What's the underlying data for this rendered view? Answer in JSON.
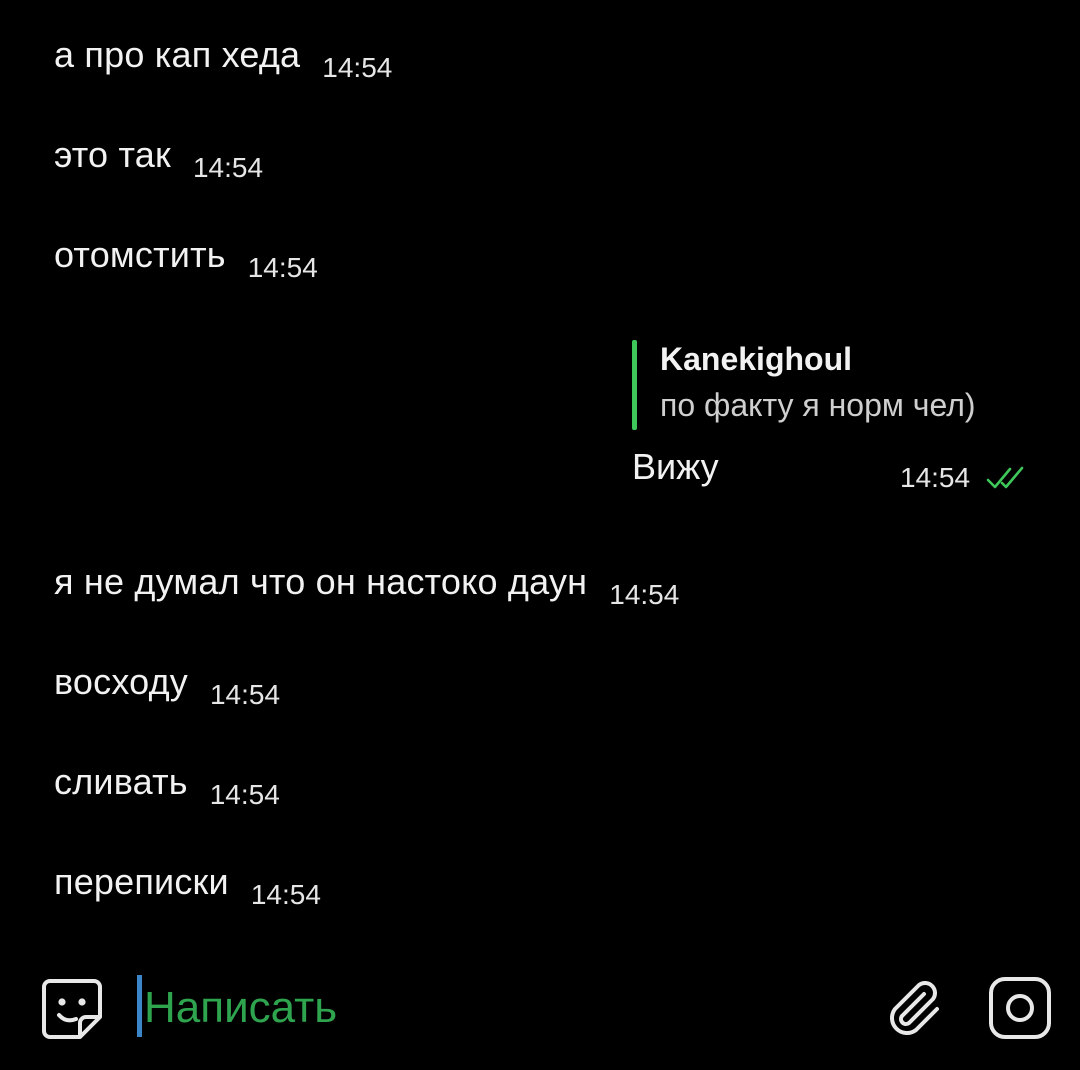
{
  "incoming_top": [
    {
      "text": "а про кап хеда",
      "time": "14:54"
    },
    {
      "text": "это так",
      "time": "14:54"
    },
    {
      "text": "отомстить",
      "time": "14:54"
    }
  ],
  "outgoing": {
    "reply_author": "Kanekighoul",
    "reply_text": "по факту я норм чел)",
    "text": "Вижу",
    "time": "14:54",
    "status_icon": "double-check-icon",
    "accent_color": "#3ec75a"
  },
  "incoming_bottom": [
    {
      "text": "я не думал что он настоко даун",
      "time": "14:54"
    },
    {
      "text": "восходу",
      "time": "14:54"
    },
    {
      "text": "сливать",
      "time": "14:54"
    },
    {
      "text": "переписки",
      "time": "14:54"
    }
  ],
  "composer": {
    "placeholder": "Написать",
    "placeholder_color": "#2fa44e",
    "left_icon": "sticker-icon",
    "right_icons": [
      "paperclip-icon",
      "camera-icon"
    ]
  }
}
